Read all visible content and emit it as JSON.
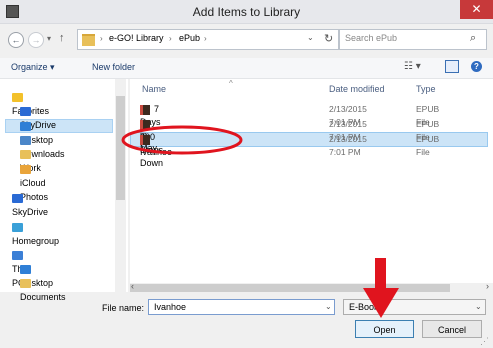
{
  "window": {
    "title": "Add Items to Library",
    "close_glyph": "✕",
    "app_icon": "app-icon"
  },
  "nav": {
    "back": "←",
    "forward": "→",
    "history": "▾",
    "up": "↑",
    "breadcrumbs": [
      "e-GO! Library",
      "ePub"
    ],
    "separator": "›",
    "address_dropdown": "⌄",
    "refresh": "↻",
    "search_placeholder": "Search ePub",
    "search_icon": "⌕"
  },
  "toolbar": {
    "organize": "Organize ▾",
    "new_folder": "New folder",
    "views": "☷ ▾",
    "help": "?"
  },
  "sidebar": {
    "items": [
      {
        "label": "Favorites",
        "icon": "star-icon",
        "color": "#f3c12b",
        "indent": false
      },
      {
        "label": "SkyDrive",
        "icon": "skydrive-icon",
        "color": "#2a6ad4",
        "indent": true
      },
      {
        "label": "Desktop",
        "icon": "desktop-icon",
        "color": "#2f7fd6",
        "indent": true,
        "selected": true
      },
      {
        "label": "Downloads",
        "icon": "downloads-icon",
        "color": "#4a86c8",
        "indent": true
      },
      {
        "label": "Work",
        "icon": "folder-icon",
        "color": "#e8c05a",
        "indent": true
      },
      {
        "label": "iCloud Photos",
        "icon": "icloud-photos-icon",
        "color": "#e9a43a",
        "indent": true
      },
      {
        "label": "SkyDrive",
        "icon": "skydrive-icon",
        "color": "#2a6ad4",
        "indent": false
      },
      {
        "label": "Homegroup",
        "icon": "homegroup-icon",
        "color": "#3aa0d8",
        "indent": false
      },
      {
        "label": "This PC",
        "icon": "computer-icon",
        "color": "#3b7fd6",
        "indent": false
      },
      {
        "label": "Desktop",
        "icon": "desktop-icon",
        "color": "#2f7fd6",
        "indent": true
      },
      {
        "label": "Documents",
        "icon": "documents-icon",
        "color": "#e8c05a",
        "indent": true
      }
    ]
  },
  "files": {
    "headers": {
      "name": "Name",
      "date": "Date modified",
      "type": "Type",
      "sort_arrow": "^"
    },
    "rows": [
      {
        "name": "7 Days in May",
        "date": "2/13/2015 7:01 PM",
        "type": "EPUB File"
      },
      {
        "name": "200 Steps Down",
        "date": "2/13/2015 7:01 PM",
        "type": "EPUB File"
      },
      {
        "name": "Ivanhoe",
        "date": "2/13/2015 7:01 PM",
        "type": "EPUB File",
        "selected": true
      }
    ],
    "scroll_left": "‹",
    "scroll_right": "›"
  },
  "bottom": {
    "file_name_label": "File name:",
    "file_name_value": "Ivanhoe",
    "dropdown_glyph": "⌄",
    "file_type_value": "E-Books",
    "open_label": "Open",
    "cancel_label": "Cancel"
  },
  "annotation": {
    "color": "#e0141e"
  }
}
